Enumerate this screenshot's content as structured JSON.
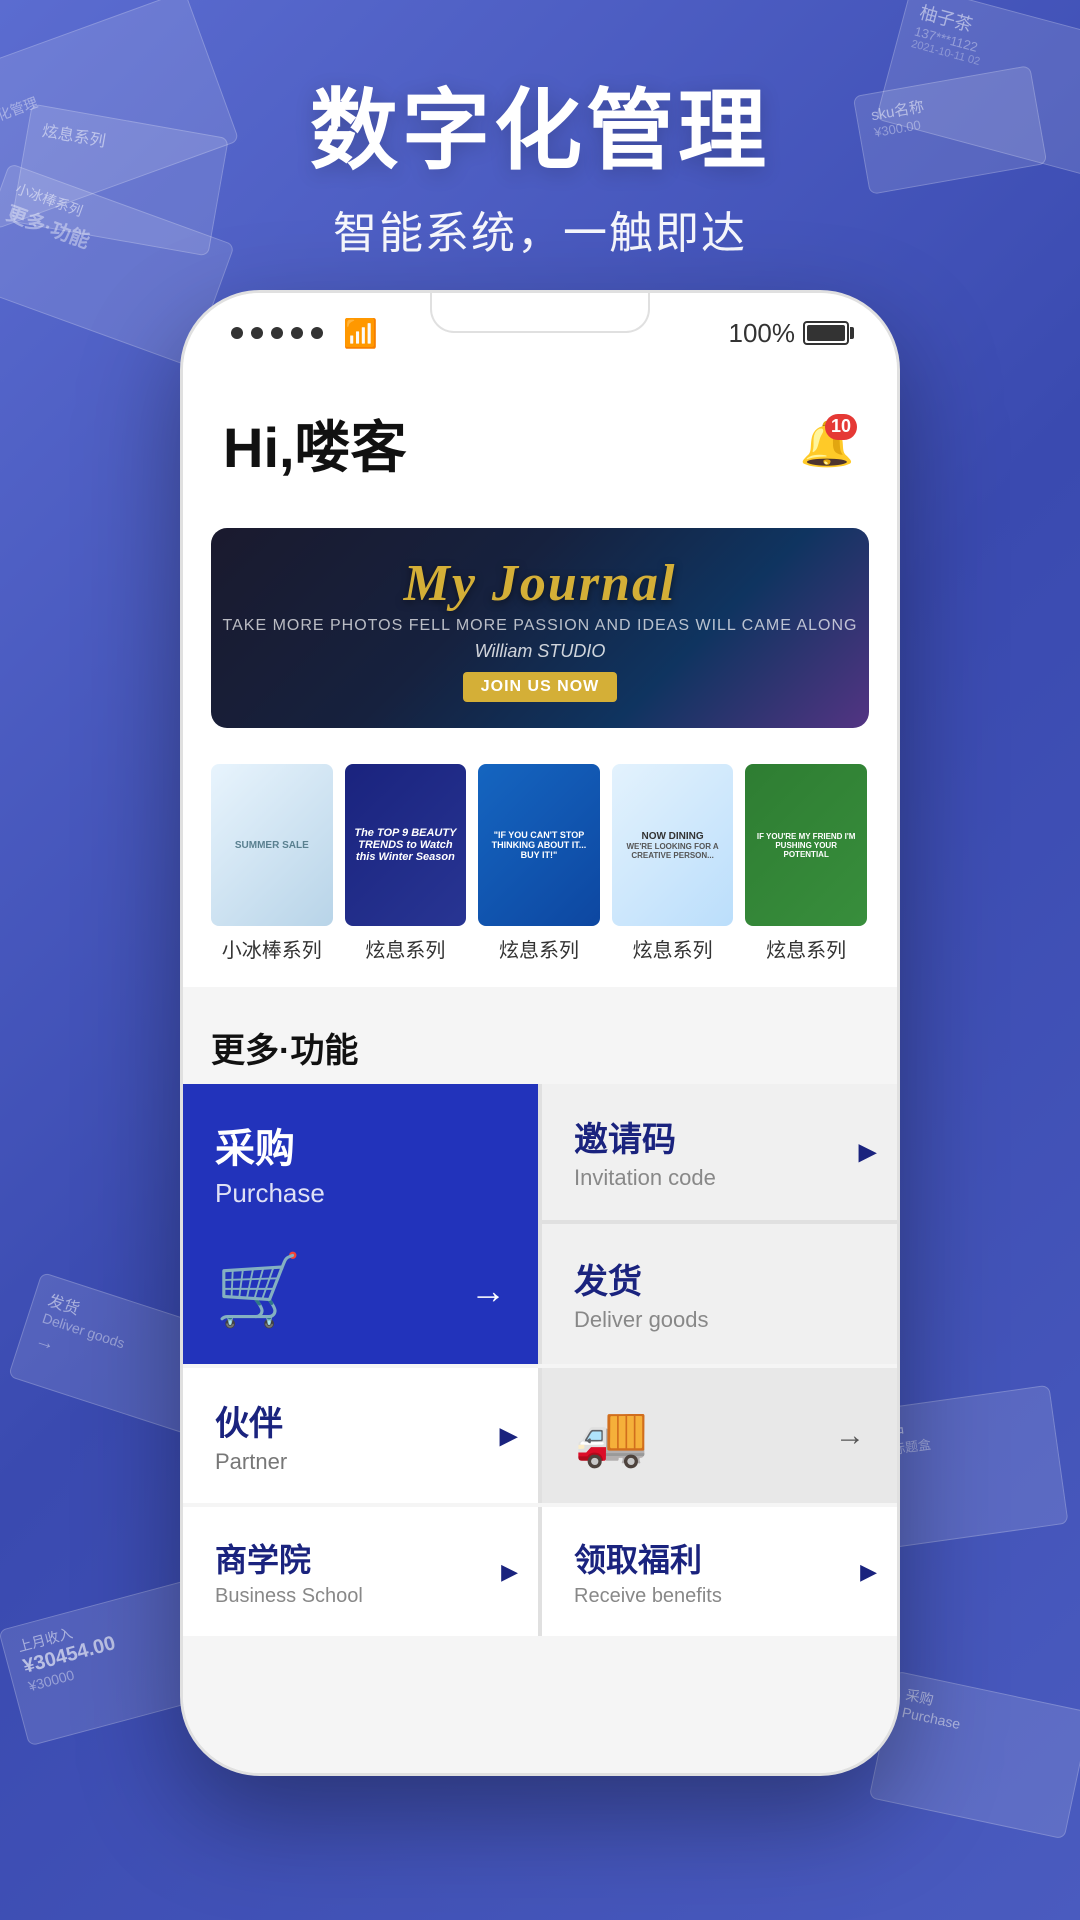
{
  "background": {
    "color": "#4a5bbf"
  },
  "hero": {
    "title": "数字化管理",
    "subtitle": "智能系统，一触即达"
  },
  "phone": {
    "status_bar": {
      "dots": 5,
      "wifi": true,
      "battery_percent": "100%"
    },
    "header": {
      "greeting": "Hi,喽客",
      "notification_badge": "10"
    },
    "banner": {
      "title": "My Journal",
      "tagline": "TAKE MORE PHOTOS FELL MORE PASSION AND IDEAS WILL CAME ALONG",
      "studio": "William STUDIO",
      "cta": "JOIN US NOW"
    },
    "series": [
      {
        "label": "小冰棒系列"
      },
      {
        "label": "炫息系列"
      },
      {
        "label": "炫息系列"
      },
      {
        "label": "炫息系列"
      },
      {
        "label": "炫息系列"
      }
    ],
    "more_section_title": "更多·功能",
    "features": {
      "purchase": {
        "zh": "采购",
        "en": "Purchase"
      },
      "invitation": {
        "zh": "邀请码",
        "en": "Invitation code"
      },
      "deliver_goods": {
        "zh": "发货",
        "en": "Deliver goods"
      },
      "partner": {
        "zh": "伙伴",
        "en": "Partner"
      },
      "business_school": {
        "zh": "商学院",
        "en": "Business School"
      },
      "receive_benefits": {
        "zh": "领取福利",
        "en": "Receive benefits"
      }
    },
    "icons": {
      "cart": "🛒",
      "truck": "🚚",
      "bell": "🔔",
      "arrow_right": "→",
      "chevron_right": "▶"
    }
  }
}
